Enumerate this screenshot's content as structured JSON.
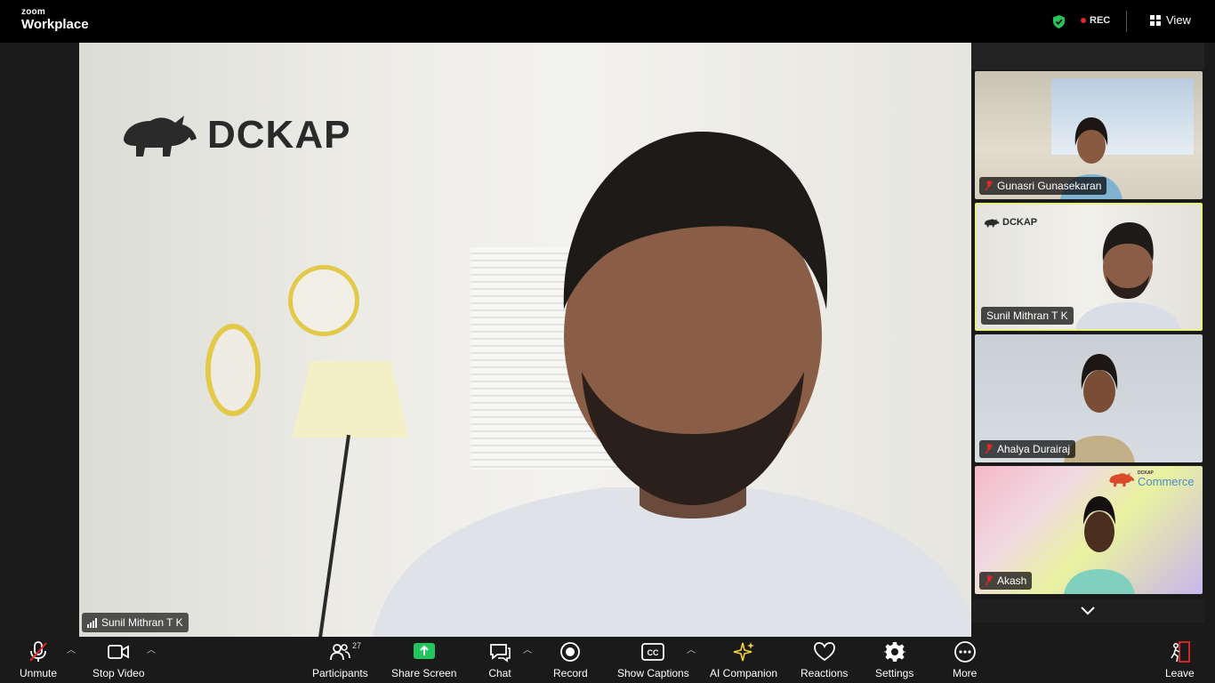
{
  "app": {
    "logo_top": "zoom",
    "logo_bottom": "Workplace"
  },
  "header": {
    "recording_label": "REC",
    "view_label": "View",
    "shield_color": "#27c35a",
    "rec_color": "#e02828"
  },
  "main_video": {
    "brand_text": "DCKAP",
    "participant_name": "Sunil Mithran T K"
  },
  "gallery": {
    "tiles": [
      {
        "name": "Gunasri Gunasekaran",
        "muted": true,
        "active": false
      },
      {
        "name": "Sunil Mithran T K",
        "muted": false,
        "active": true
      },
      {
        "name": "Ahalya Durairaj",
        "muted": true,
        "active": false
      },
      {
        "name": "Akash",
        "muted": true,
        "active": false
      }
    ],
    "tile4_brand_text": "Commerce",
    "tile4_brand_small": "DCKAP",
    "tile2_brand_text": "DCKAP"
  },
  "toolbar": {
    "unmute": "Unmute",
    "stop_video": "Stop Video",
    "participants": "Participants",
    "participants_count": "27",
    "share_screen": "Share Screen",
    "chat": "Chat",
    "record": "Record",
    "show_captions": "Show Captions",
    "ai_companion": "AI Companion",
    "reactions": "Reactions",
    "settings": "Settings",
    "more": "More",
    "leave": "Leave",
    "accent_green": "#23c55e",
    "leave_color": "#e02828",
    "ai_color": "#f5d33b"
  }
}
